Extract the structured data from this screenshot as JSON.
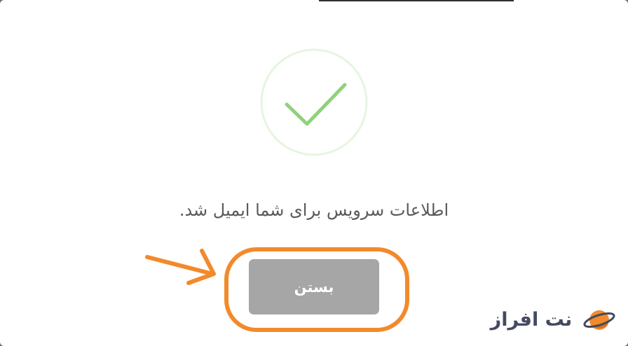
{
  "dialog": {
    "status_icon": "checkmark-circle-icon",
    "message": "اطلاعات سرویس برای شما ایمیل شد.",
    "close_button_label": "بستن"
  },
  "annotation": {
    "highlight_color": "#f28a2c",
    "pointer": "arrow-icon"
  },
  "watermark": {
    "logo_text": "نت افراز",
    "logo_icon": "planet-icon"
  },
  "colors": {
    "success_green": "#8fd27a",
    "success_ring": "#e6f5e0",
    "button_gray": "#a6a6a6",
    "message_text": "#595959"
  }
}
